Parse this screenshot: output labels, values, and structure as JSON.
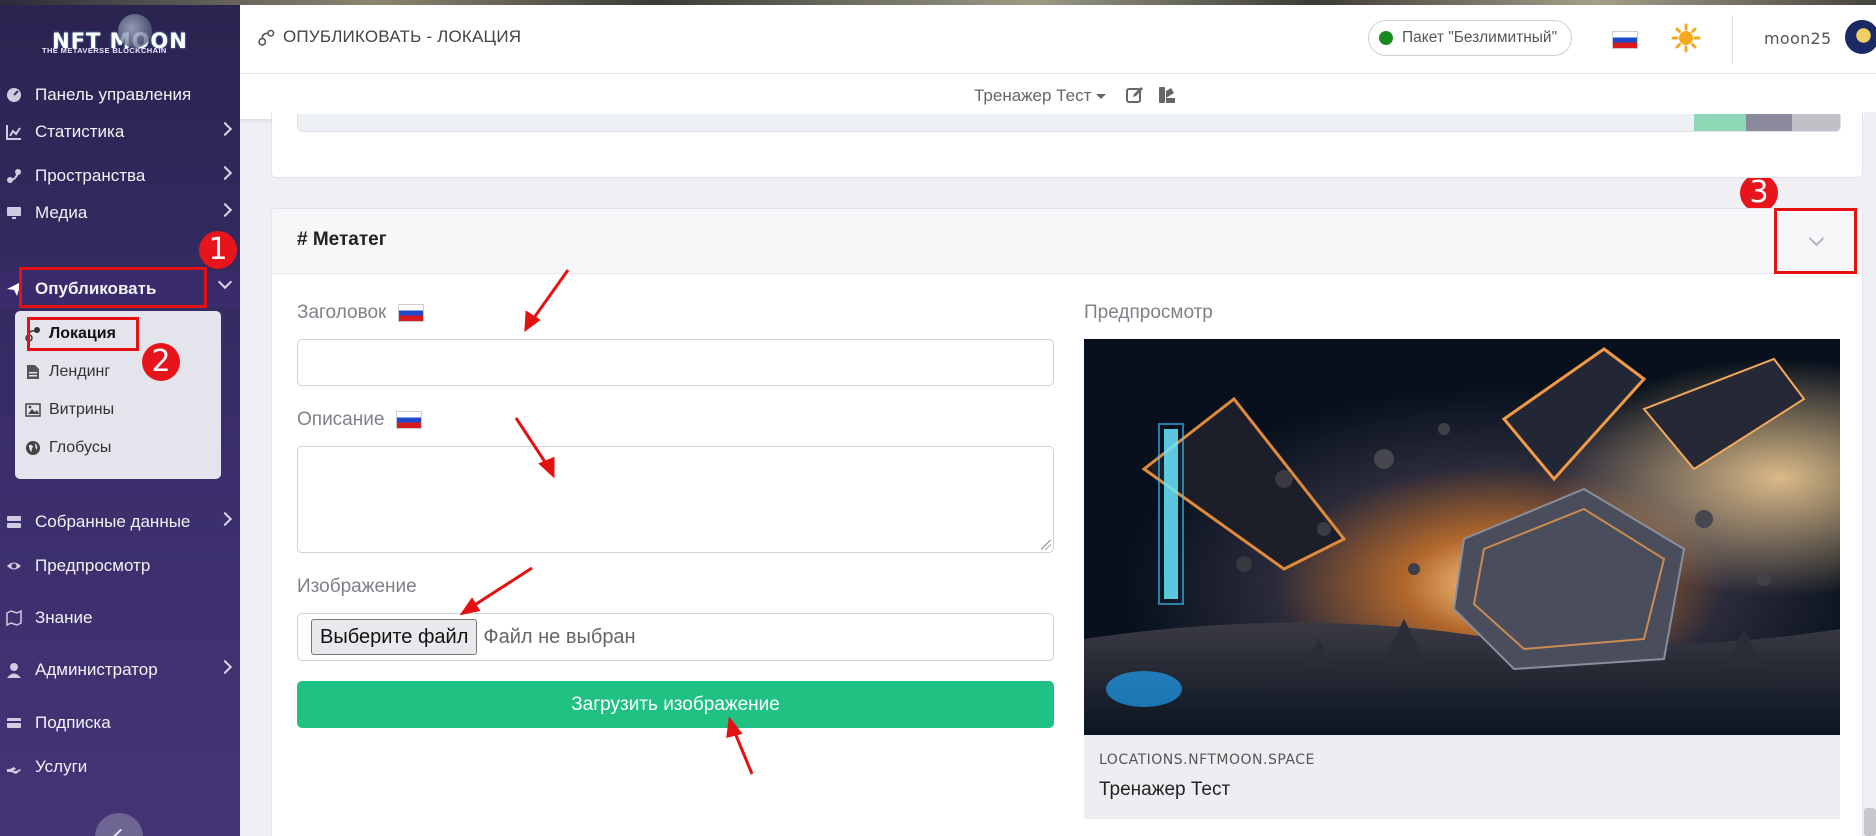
{
  "brand": {
    "name": "NFT MOON",
    "tagline": "THE METAVERSE BLOCKCHAIN"
  },
  "sidebar": {
    "items": [
      {
        "label": "Панель управления",
        "icon": "gauge-icon"
      },
      {
        "label": "Статистика",
        "icon": "chart-icon",
        "has_children": true
      },
      {
        "label": "Пространства",
        "icon": "route-icon",
        "has_children": true
      },
      {
        "label": "Медиа",
        "icon": "desktop-icon",
        "has_children": true
      },
      {
        "label": "Опубликовать",
        "icon": "paper-plane-icon",
        "expanded": true
      },
      {
        "label": "Собранные данные",
        "icon": "server-icon",
        "has_children": true
      },
      {
        "label": "Предпросмотр",
        "icon": "eye-icon"
      },
      {
        "label": "Знание",
        "icon": "map-icon"
      },
      {
        "label": "Администратор",
        "icon": "user-icon",
        "has_children": true
      },
      {
        "label": "Подписка",
        "icon": "card-icon"
      },
      {
        "label": "Услуги",
        "icon": "hand-icon"
      }
    ],
    "submenu": [
      {
        "label": "Локация",
        "icon": "route-icon",
        "active": true
      },
      {
        "label": "Лендинг",
        "icon": "file-icon"
      },
      {
        "label": "Витрины",
        "icon": "image-icon"
      },
      {
        "label": "Глобусы",
        "icon": "globe-icon"
      }
    ]
  },
  "header": {
    "breadcrumb": "ОПУБЛИКОВАТЬ - ЛОКАЦИЯ",
    "package": "Пакет \"Безлимитный\"",
    "language": "ru",
    "username": "moon25"
  },
  "subheader": {
    "project": "Тренажер Тест"
  },
  "metatag": {
    "title": "# Метатег",
    "title_label": "Заголовок",
    "title_value": "",
    "description_label": "Описание",
    "description_value": "",
    "image_label": "Изображение",
    "file_button": "Выберите файл",
    "file_status": "Файл не выбран",
    "upload_button": "Загрузить изображение",
    "preview_label": "Предпросмотр",
    "preview_domain": "LOCATIONS.NFTMOON.SPACE",
    "preview_name": "Тренажер Тест"
  },
  "annotations": [
    "1",
    "2",
    "3"
  ],
  "colors": {
    "sidebar": "#3b2e6b",
    "accent_green": "#1fc283",
    "annotation_red": "#e51111"
  }
}
